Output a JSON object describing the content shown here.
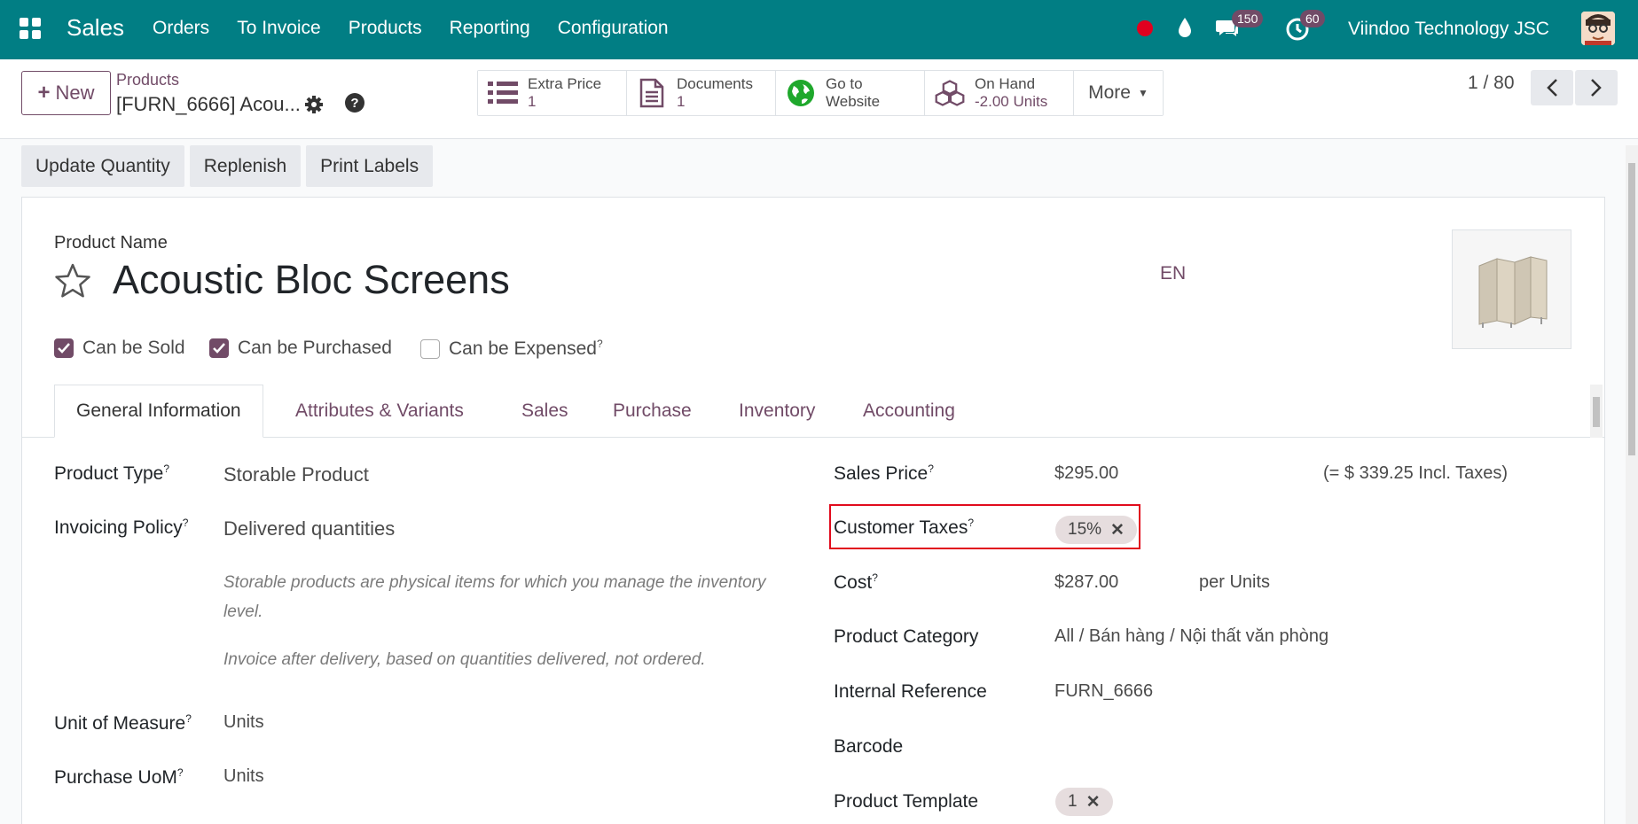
{
  "navbar": {
    "brand": "Sales",
    "menu": [
      "Orders",
      "To Invoice",
      "Products",
      "Reporting",
      "Configuration"
    ],
    "messages_count": "150",
    "activities_count": "60",
    "company": "Viindoo Technology JSC",
    "accent_color": "#017e84"
  },
  "control": {
    "new_label": "New",
    "breadcrumb_parent": "Products",
    "breadcrumb_current": "[FURN_6666] Acou...",
    "stats": [
      {
        "label": "Extra Price",
        "value": "1",
        "icon": "list-icon"
      },
      {
        "label": "Documents",
        "value": "1",
        "icon": "document-icon"
      },
      {
        "label": "Go to",
        "value": "Website",
        "icon": "globe-icon"
      },
      {
        "label": "On Hand",
        "value": "-2.00 Units",
        "icon": "cubes-icon"
      }
    ],
    "more_label": "More",
    "pager": "1 / 80"
  },
  "actions": [
    "Update Quantity",
    "Replenish",
    "Print Labels"
  ],
  "form": {
    "name_label": "Product Name",
    "name": "Acoustic Bloc Screens",
    "lang": "EN",
    "checkboxes": [
      {
        "label": "Can be Sold",
        "checked": true
      },
      {
        "label": "Can be Purchased",
        "checked": true
      },
      {
        "label": "Can be Expensed",
        "checked": false
      }
    ],
    "tabs": [
      "General Information",
      "Attributes & Variants",
      "Sales",
      "Purchase",
      "Inventory",
      "Accounting"
    ],
    "left": {
      "product_type_label": "Product Type",
      "product_type": "Storable Product",
      "invoicing_policy_label": "Invoicing Policy",
      "invoicing_policy": "Delivered quantities",
      "help_1": "Storable products are physical items for which you manage the inventory level.",
      "help_2": "Invoice after delivery, based on quantities delivered, not ordered.",
      "uom_label": "Unit of Measure",
      "uom": "Units",
      "purchase_uom_label": "Purchase UoM",
      "purchase_uom": "Units"
    },
    "right": {
      "sales_price_label": "Sales Price",
      "sales_price": "$295.00",
      "incl_taxes": "(= $ 339.25 Incl. Taxes)",
      "customer_taxes_label": "Customer Taxes",
      "customer_tax_tag": "15%",
      "cost_label": "Cost",
      "cost": "$287.00",
      "cost_unit": "per Units",
      "category_label": "Product Category",
      "category": "All / Bán hàng / Nội thất văn phòng",
      "internal_ref_label": "Internal Reference",
      "internal_ref": "FURN_6666",
      "barcode_label": "Barcode",
      "template_label": "Product Template",
      "template_tag": "1"
    }
  }
}
